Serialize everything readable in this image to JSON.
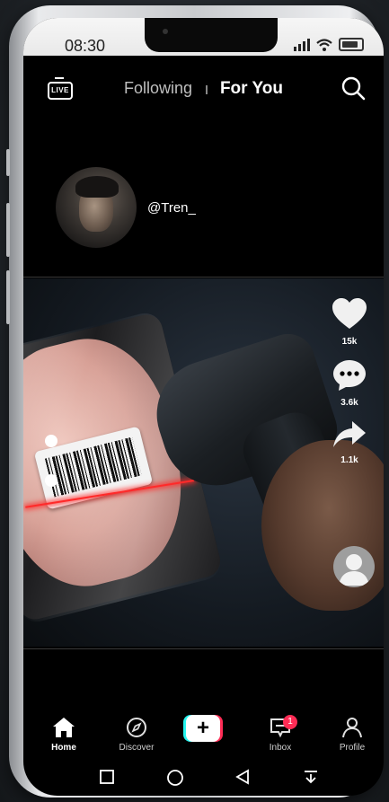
{
  "status": {
    "time": "08:30"
  },
  "topnav": {
    "following_label": "Following",
    "foryou_label": "For You",
    "live_label": "LIVE"
  },
  "post": {
    "username": "@Tren_"
  },
  "actions": {
    "likes": "15k",
    "comments": "3.6k",
    "shares": "1.1k"
  },
  "bottom_nav": {
    "home": "Home",
    "discover": "Discover",
    "create_symbol": "+",
    "inbox": "Inbox",
    "inbox_badge": "1",
    "profile": "Profile"
  },
  "colors": {
    "accent_red": "#fe2c55",
    "accent_cyan": "#25f4ee",
    "laser": "#ff2a2a"
  }
}
